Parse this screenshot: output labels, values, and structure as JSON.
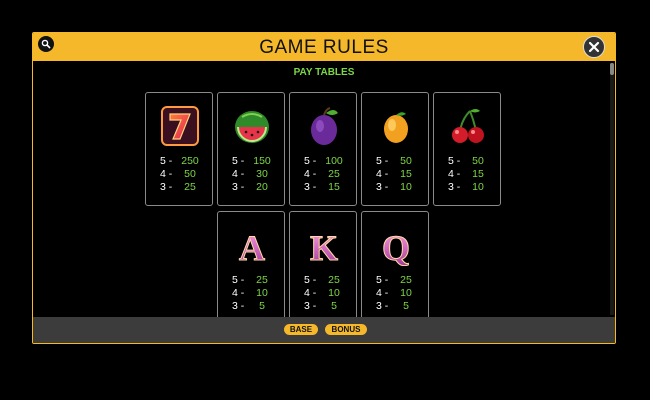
{
  "header": {
    "title": "GAME RULES"
  },
  "section": {
    "title": "PAY TABLES"
  },
  "symbols": [
    {
      "icon": "seven-icon",
      "pays": [
        {
          "count": "5 -",
          "value": "250"
        },
        {
          "count": "4 -",
          "value": "50"
        },
        {
          "count": "3 -",
          "value": "25"
        }
      ]
    },
    {
      "icon": "watermelon-icon",
      "pays": [
        {
          "count": "5 -",
          "value": "150"
        },
        {
          "count": "4 -",
          "value": "30"
        },
        {
          "count": "3 -",
          "value": "20"
        }
      ]
    },
    {
      "icon": "plum-icon",
      "pays": [
        {
          "count": "5 -",
          "value": "100"
        },
        {
          "count": "4 -",
          "value": "25"
        },
        {
          "count": "3 -",
          "value": "15"
        }
      ]
    },
    {
      "icon": "lemon-icon",
      "pays": [
        {
          "count": "5 -",
          "value": "50"
        },
        {
          "count": "4 -",
          "value": "15"
        },
        {
          "count": "3 -",
          "value": "10"
        }
      ]
    },
    {
      "icon": "cherry-icon",
      "pays": [
        {
          "count": "5 -",
          "value": "50"
        },
        {
          "count": "4 -",
          "value": "15"
        },
        {
          "count": "3 -",
          "value": "10"
        }
      ]
    },
    {
      "icon": "letter-a-icon",
      "letter": "A",
      "pays": [
        {
          "count": "5 -",
          "value": "25"
        },
        {
          "count": "4 -",
          "value": "10"
        },
        {
          "count": "3 -",
          "value": "5"
        }
      ]
    },
    {
      "icon": "letter-k-icon",
      "letter": "K",
      "pays": [
        {
          "count": "5 -",
          "value": "25"
        },
        {
          "count": "4 -",
          "value": "10"
        },
        {
          "count": "3 -",
          "value": "5"
        }
      ]
    },
    {
      "icon": "letter-q-icon",
      "letter": "Q",
      "pays": [
        {
          "count": "5 -",
          "value": "25"
        },
        {
          "count": "4 -",
          "value": "10"
        },
        {
          "count": "3 -",
          "value": "5"
        }
      ]
    }
  ],
  "footer": {
    "base_label": "BASE",
    "bonus_label": "BONUS"
  },
  "colors": {
    "accent": "#f5b82a",
    "payout": "#7dd646",
    "footer_bg": "#3c3c3c"
  }
}
